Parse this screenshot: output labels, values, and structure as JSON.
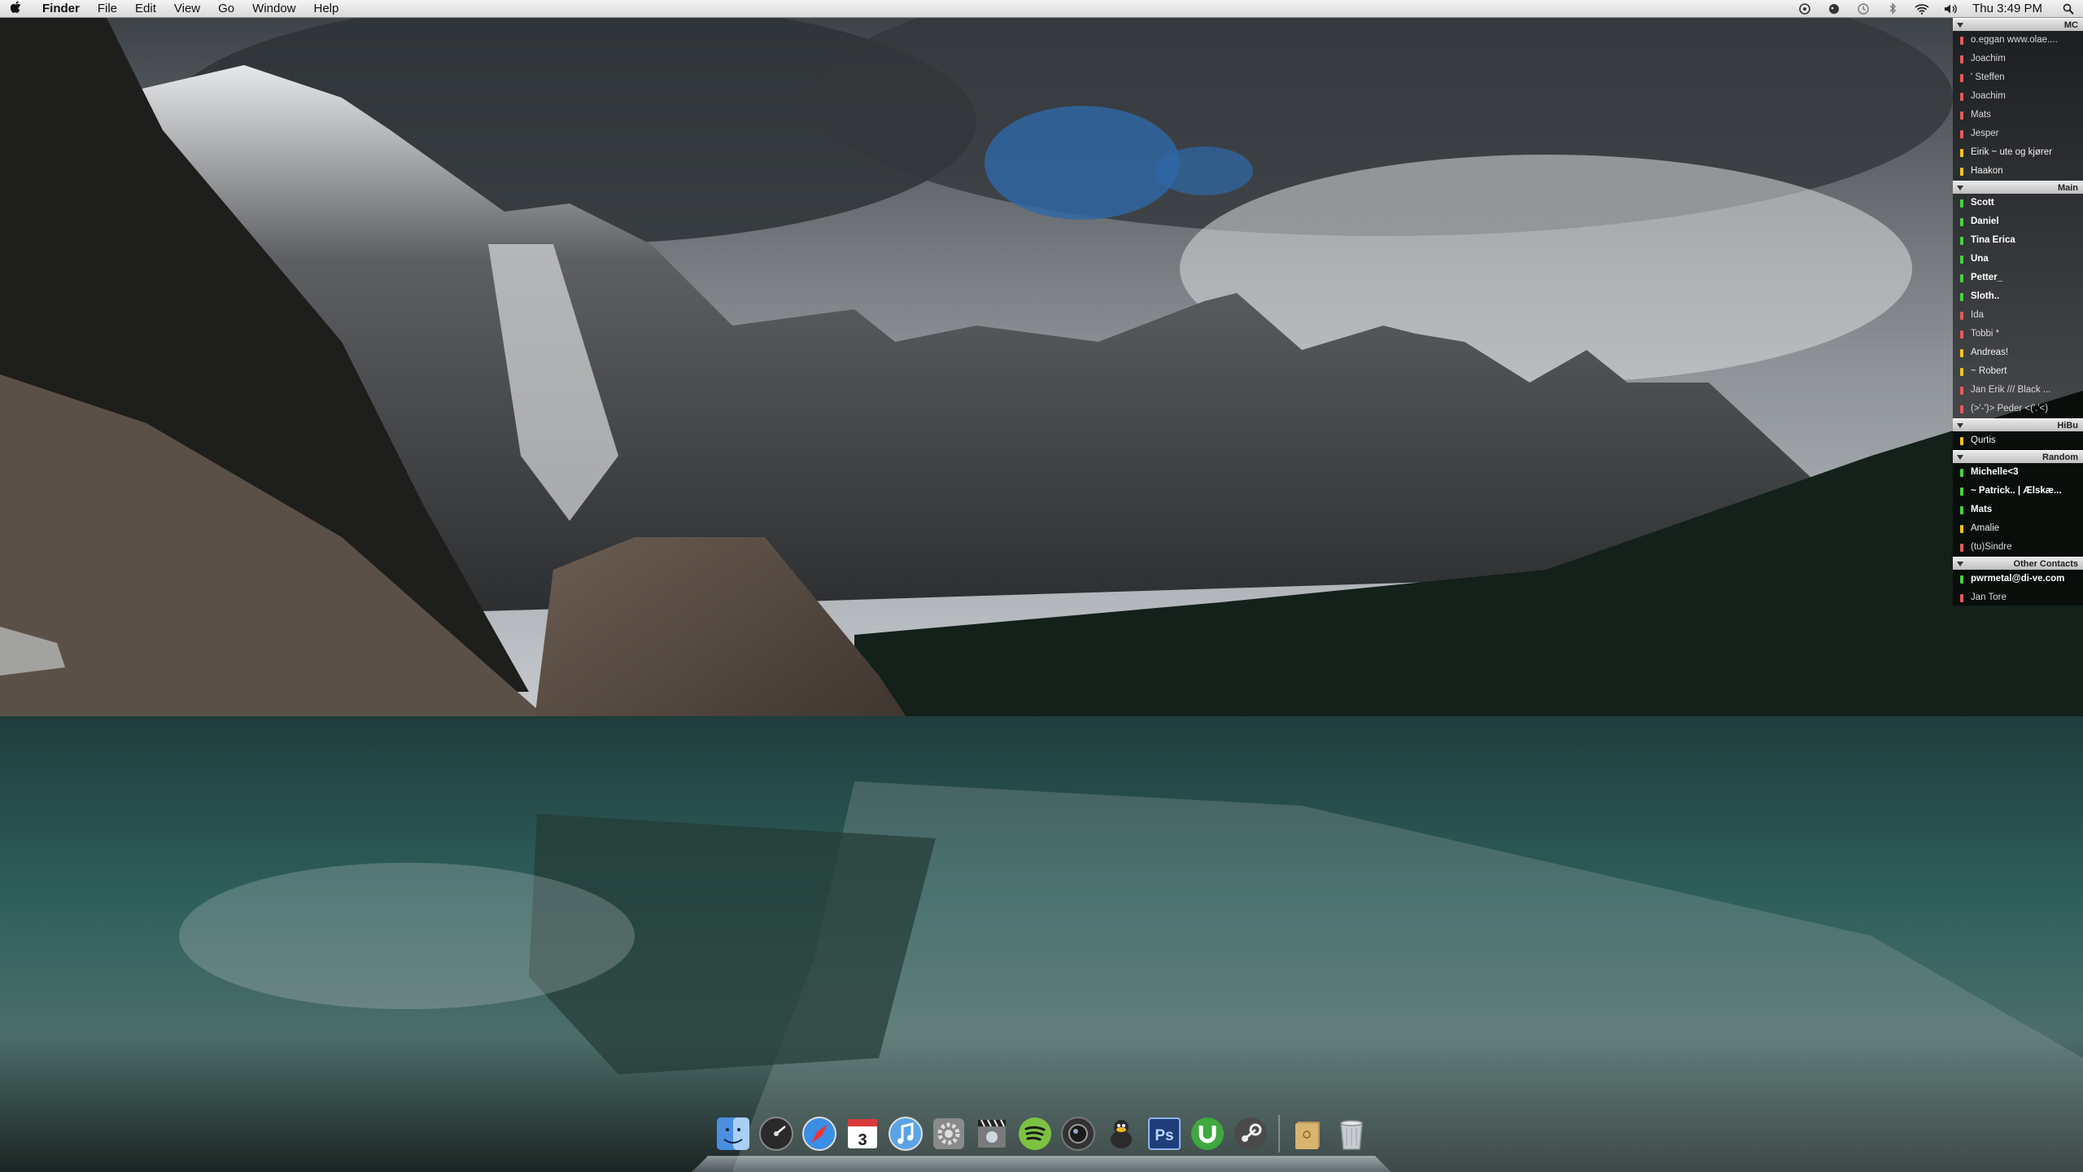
{
  "menubar": {
    "app_name": "Finder",
    "menus": [
      "File",
      "Edit",
      "View",
      "Go",
      "Window",
      "Help"
    ],
    "clock": "Thu 3:49 PM",
    "status_icons": [
      "skype-icon",
      "adium-icon",
      "time-machine-icon",
      "bluetooth-icon",
      "wifi-icon",
      "volume-icon",
      "spotlight-icon"
    ]
  },
  "buddylist": {
    "groups": [
      {
        "name": "MC",
        "contacts": [
          {
            "name": "o.eggan www.olae....",
            "status": "red"
          },
          {
            "name": "Joachim",
            "status": "red"
          },
          {
            "name": "'  Steffen",
            "status": "red"
          },
          {
            "name": "Joachim",
            "status": "red"
          },
          {
            "name": "Mats",
            "status": "red"
          },
          {
            "name": "Jesper",
            "status": "red"
          },
          {
            "name": "Eirik ~ ute og kjører",
            "status": "yellow"
          },
          {
            "name": "Haakon",
            "status": "yellow"
          }
        ]
      },
      {
        "name": "Main",
        "contacts": [
          {
            "name": "Scott",
            "status": "green"
          },
          {
            "name": "Daniel",
            "status": "green"
          },
          {
            "name": "Tina Erica",
            "status": "green"
          },
          {
            "name": "Una",
            "status": "green"
          },
          {
            "name": "Petter_",
            "status": "green"
          },
          {
            "name": "Sloth..",
            "status": "green"
          },
          {
            "name": "Ida",
            "status": "red"
          },
          {
            "name": "Tobbi *",
            "status": "red"
          },
          {
            "name": "Andreas!",
            "status": "yellow"
          },
          {
            "name": "~ Robert",
            "status": "yellow"
          },
          {
            "name": "Jan Erik /// Black ...",
            "status": "red"
          },
          {
            "name": "(>'-')> Peder <('.'<)",
            "status": "red"
          }
        ]
      },
      {
        "name": "HiBu",
        "contacts": [
          {
            "name": "Qurtis",
            "status": "yellow"
          }
        ]
      },
      {
        "name": "Random",
        "contacts": [
          {
            "name": "Michelle<3",
            "status": "green"
          },
          {
            "name": "~ Patrick.. | Ælskæ...",
            "status": "green"
          },
          {
            "name": "Mats",
            "status": "green"
          },
          {
            "name": "Amalie",
            "status": "yellow"
          },
          {
            "name": "(tu)Sindre",
            "status": "red"
          }
        ]
      },
      {
        "name": "Other Contacts",
        "contacts": [
          {
            "name": "pwrmetal@di-ve.com",
            "status": "green"
          },
          {
            "name": "Jan Tore",
            "status": "red"
          }
        ]
      }
    ]
  },
  "dock": {
    "items": [
      {
        "name": "finder-icon",
        "color": "#4a8fe0"
      },
      {
        "name": "dashboard-icon",
        "color": "#2a2a2a"
      },
      {
        "name": "safari-icon",
        "color": "#3a8ee6"
      },
      {
        "name": "ical-icon",
        "color": "#ffffff",
        "label": "3"
      },
      {
        "name": "itunes-icon",
        "color": "#5aa4e6"
      },
      {
        "name": "system-preferences-icon",
        "color": "#8a8a8a"
      },
      {
        "name": "imovie-icon",
        "color": "#7a7a7a"
      },
      {
        "name": "spotify-icon",
        "color": "#7cc242"
      },
      {
        "name": "aperture-icon",
        "color": "#333333"
      },
      {
        "name": "adium-duck-icon",
        "color": "#2b2b2b"
      },
      {
        "name": "photoshop-icon",
        "color": "#1f3d7a",
        "label": "Ps"
      },
      {
        "name": "utorrent-icon",
        "color": "#3fa83f"
      },
      {
        "name": "steam-icon",
        "color": "#4a4a4a"
      },
      {
        "name": "documents-stack-icon",
        "color": "#d8b470"
      },
      {
        "name": "trash-icon",
        "color": "#c8ccd0"
      }
    ]
  }
}
